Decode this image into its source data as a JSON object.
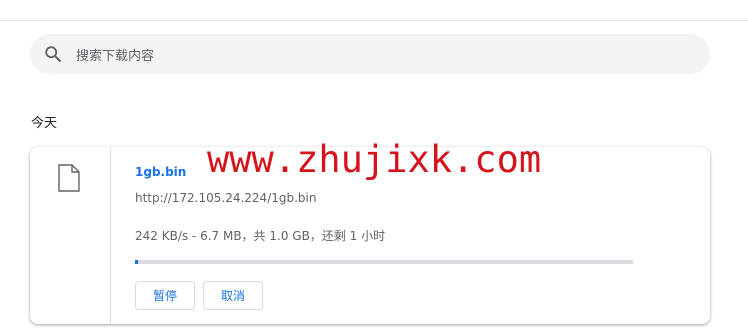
{
  "search": {
    "placeholder": "搜索下载内容"
  },
  "section": {
    "label": "今天"
  },
  "download": {
    "filename": "1gb.bin",
    "url": "http://172.105.24.224/1gb.bin",
    "status": "242 KB/s - 6.7 MB，共 1.0 GB，还剩 1 小时",
    "progress_fraction": 0.0067,
    "pause_label": "暂停",
    "cancel_label": "取消"
  },
  "watermark": {
    "text": "www.zhujixk.com"
  },
  "colors": {
    "accent": "#1a73e8",
    "watermark": "#d4141c"
  },
  "icons": {
    "search": "search-icon",
    "file": "file-icon"
  }
}
